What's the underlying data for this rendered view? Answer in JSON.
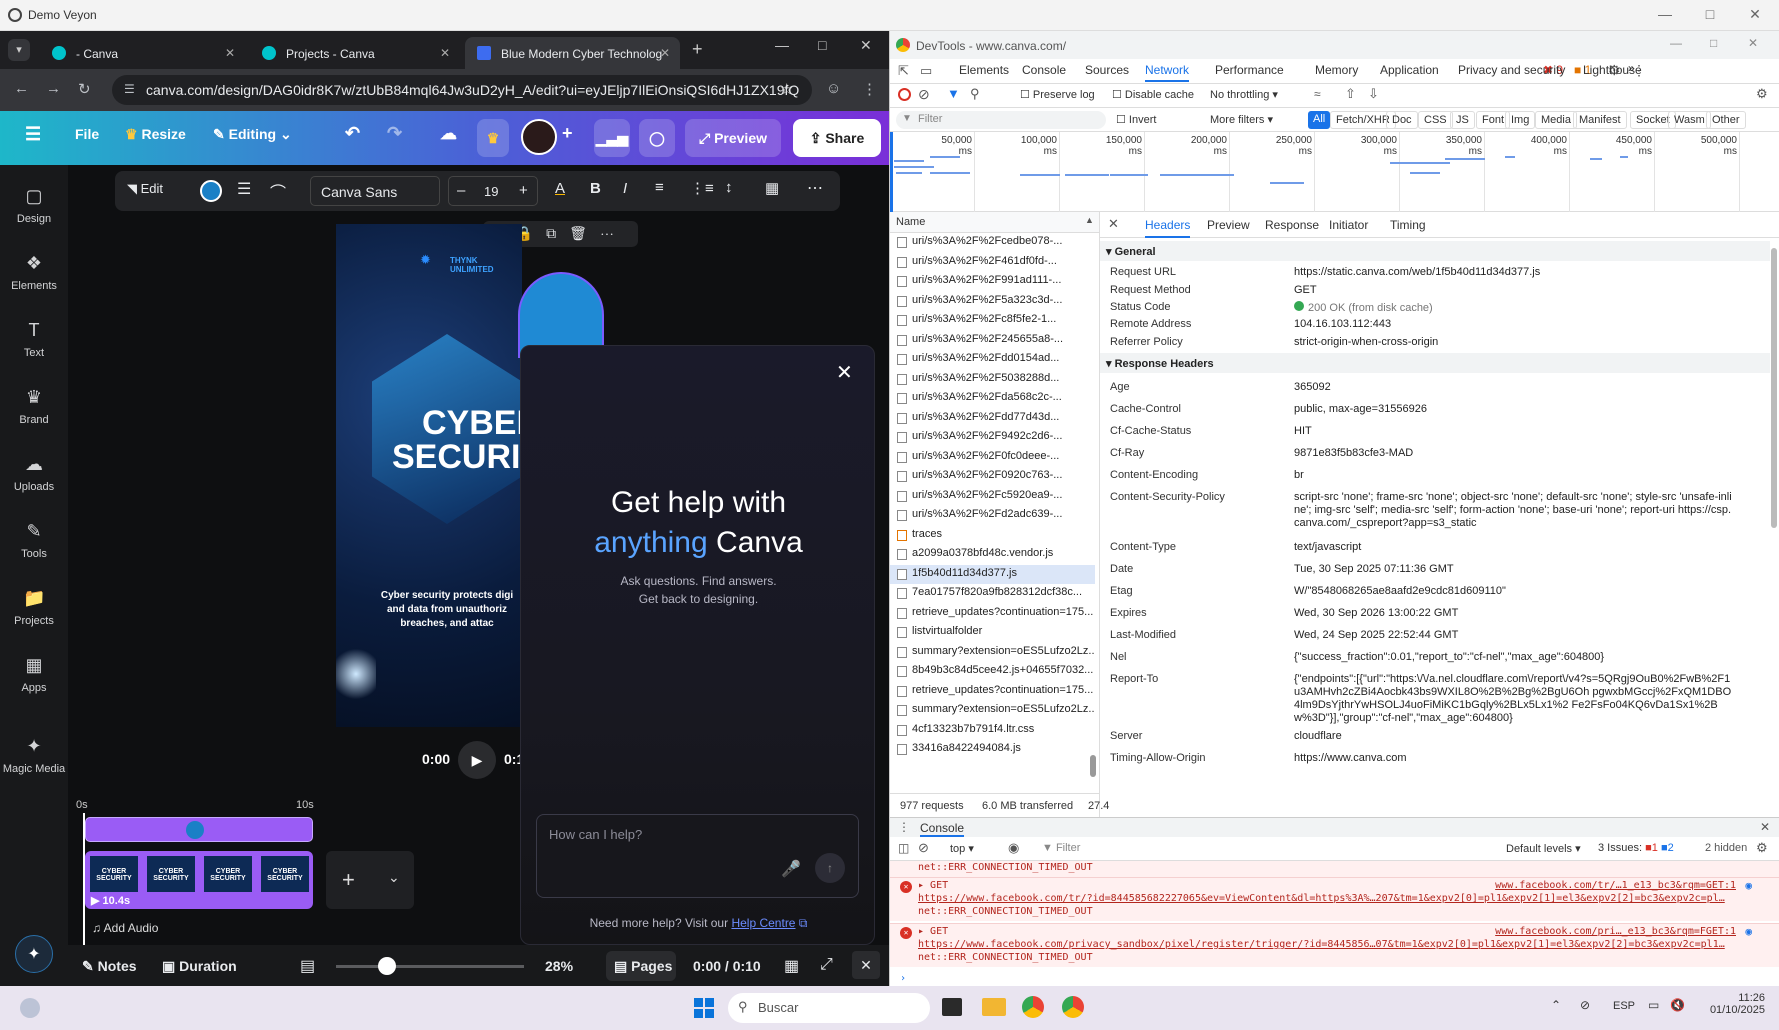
{
  "app_window": {
    "title": "Demo Veyon"
  },
  "browser": {
    "tabs": [
      {
        "label": "- Canva"
      },
      {
        "label": "Projects - Canva"
      },
      {
        "label": "Blue Modern Cyber Technolog"
      }
    ],
    "url": "canva.com/design/DAG0idr8K7w/ztUbB84mql64Jw3uD2yH_A/edit?ui=eyJEljp7IlEiOnsiQSI6dHJ1ZX19fQ"
  },
  "canva": {
    "header": {
      "file": "File",
      "resize": "Resize",
      "editing": "Editing",
      "preview": "Preview",
      "share": "Share"
    },
    "rail": [
      {
        "label": "Design",
        "icon": "design-icon"
      },
      {
        "label": "Elements",
        "icon": "elements-icon"
      },
      {
        "label": "Text",
        "icon": "text-icon"
      },
      {
        "label": "Brand",
        "icon": "brand-icon"
      },
      {
        "label": "Uploads",
        "icon": "uploads-icon"
      },
      {
        "label": "Tools",
        "icon": "tools-icon"
      },
      {
        "label": "Projects",
        "icon": "projects-icon"
      },
      {
        "label": "Apps",
        "icon": "apps-icon"
      },
      {
        "label": "Magic Media",
        "icon": "magic-media-icon"
      }
    ],
    "toolbar": {
      "edit": "Edit",
      "font": "Canva Sans",
      "font_size": "19",
      "minus": "–",
      "plus": "+"
    },
    "design": {
      "brand": "THYNK UNLIMITED",
      "title1": "CYBER",
      "title2": "SECURI",
      "body": "Cyber security protects digi and data from unauthoriz breaches, and attac"
    },
    "playback": {
      "time": "0:00",
      "time2": "0:1"
    },
    "help_panel": {
      "title1": "Get help with",
      "title2_accent": "anything",
      "title2_rest": "Canva",
      "sub1": "Ask questions. Find answers.",
      "sub2": "Get back to designing.",
      "input_placeholder": "How can I help?",
      "footer_prefix": "Need more help? Visit our",
      "footer_link": "Help Centre"
    },
    "timeline": {
      "start": "0s",
      "mark": "10s",
      "clip_label": "CYBER SECURITY",
      "duration_badge": "10.4s",
      "add_audio": "Add Audio"
    },
    "bottom": {
      "notes": "Notes",
      "duration": "Duration",
      "zoom": "28%",
      "pages": "Pages",
      "time": "0:00 / 0:10"
    }
  },
  "devtools": {
    "title": "DevTools - www.canva.com/",
    "tabs": [
      "Elements",
      "Console",
      "Sources",
      "Network",
      "Performance",
      "Memory",
      "Application",
      "Privacy and security",
      "Lighthouse"
    ],
    "active_tab": "Network",
    "errors": "9",
    "warnings": "1",
    "toolbar": {
      "preserve_log": "Preserve log",
      "disable_cache": "Disable cache",
      "throttling": "No throttling"
    },
    "filter": {
      "placeholder": "Filter",
      "invert": "Invert",
      "more_filters": "More filters"
    },
    "filter_types": [
      "All",
      "Fetch/XHR",
      "Doc",
      "CSS",
      "JS",
      "Font",
      "Img",
      "Media",
      "Manifest",
      "Socket",
      "Wasm",
      "Other"
    ],
    "timeline_ticks": [
      "50,000 ms",
      "100,000 ms",
      "150,000 ms",
      "200,000 ms",
      "250,000 ms",
      "300,000 ms",
      "350,000 ms",
      "400,000 ms",
      "450,000 ms",
      "500,000 ms"
    ],
    "name_header": "Name",
    "requests": [
      "uri/s%3A%2F%2Fcedbe078-...",
      "uri/s%3A%2F%2F461df0fd-...",
      "uri/s%3A%2F%2F991ad111-...",
      "uri/s%3A%2F%2F5a323c3d-...",
      "uri/s%3A%2F%2Fc8f5fe2-1...",
      "uri/s%3A%2F%2F245655a8-...",
      "uri/s%3A%2F%2Fdd0154ad...",
      "uri/s%3A%2F%2F5038288d...",
      "uri/s%3A%2F%2Fda568c2c-...",
      "uri/s%3A%2F%2Fdd77d43d...",
      "uri/s%3A%2F%2F9492c2d6-...",
      "uri/s%3A%2F%2F0fc0deee-...",
      "uri/s%3A%2F%2F0920c763-...",
      "uri/s%3A%2F%2Fc5920ea9-...",
      "uri/s%3A%2F%2Fd2adc639-...",
      "traces",
      "a2099a0378bfd48c.vendor.js",
      "1f5b40d11d34d377.js",
      "7ea01757f820a9fb828312dcf38c...",
      "retrieve_updates?continuation=175...",
      "listvirtualfolder",
      "summary?extension=oES5Lufzo2Lz...",
      "8b49b3c84d5cee42.js+04655f7032...",
      "retrieve_updates?continuation=175...",
      "summary?extension=oES5Lufzo2Lz...",
      "4cf13323b7b791f4.ltr.css",
      "33416a8422494084.js"
    ],
    "summary": {
      "requests": "977 requests",
      "transferred": "6.0 MB transferred",
      "extra": "27.4"
    },
    "detail_tabs": [
      "Headers",
      "Preview",
      "Response",
      "Initiator",
      "Timing"
    ],
    "general_title": "General",
    "general": [
      {
        "k": "Request URL",
        "v": "https://static.canva.com/web/1f5b40d11d34d377.js"
      },
      {
        "k": "Request Method",
        "v": "GET"
      },
      {
        "k": "Status Code",
        "v": "200 OK (from disk cache)"
      },
      {
        "k": "Remote Address",
        "v": "104.16.103.112:443"
      },
      {
        "k": "Referrer Policy",
        "v": "strict-origin-when-cross-origin"
      }
    ],
    "response_title": "Response Headers",
    "response": [
      {
        "k": "Age",
        "v": "365092"
      },
      {
        "k": "Cache-Control",
        "v": "public, max-age=31556926"
      },
      {
        "k": "Cf-Cache-Status",
        "v": "HIT"
      },
      {
        "k": "Cf-Ray",
        "v": "9871e83f5b83cfe3-MAD"
      },
      {
        "k": "Content-Encoding",
        "v": "br"
      },
      {
        "k": "Content-Security-Policy",
        "v": "script-src 'none'; frame-src 'none'; object-src 'none'; default-src 'none'; style-src 'unsafe-inline'; img-src 'self'; media-src 'self'; form-action 'none'; base-uri 'none'; report-uri https://csp.canva.com/_cspreport?app=s3_static"
      },
      {
        "k": "Content-Type",
        "v": "text/javascript"
      },
      {
        "k": "Date",
        "v": "Tue, 30 Sep 2025 07:11:36 GMT"
      },
      {
        "k": "Etag",
        "v": "W/\"8548068265ae8aafd2e9cdc81d609110\""
      },
      {
        "k": "Expires",
        "v": "Wed, 30 Sep 2026 13:00:22 GMT"
      },
      {
        "k": "Last-Modified",
        "v": "Wed, 24 Sep 2025 22:52:44 GMT"
      },
      {
        "k": "Nel",
        "v": "{\"success_fraction\":0.01,\"report_to\":\"cf-nel\",\"max_age\":604800}"
      },
      {
        "k": "Report-To",
        "v": "{\"endpoints\":[{\"url\":\"https:\\/\\/a.nel.cloudflare.com\\/report\\/v4?s=5QRgj9OuB0%2FwB%2F1u3AMHvh2cZBi4Aocbk43bs9WXIL8O%2B%2Bg%2BgU6Oh pgwxbMGccj%2FxQM1DBO4lm9DsYjthrYwHSOLJ4uoFiMiKC1bGqly%2BLx5Lx1%2 Fe2FsFo04KQ6vDa1Sx1%2Bw%3D\"}],\"group\":\"cf-nel\",\"max_age\":604800}"
      },
      {
        "k": "Server",
        "v": "cloudflare"
      },
      {
        "k": "Timing-Allow-Origin",
        "v": "https://www.canva.com"
      }
    ],
    "console": {
      "title": "Console",
      "context": "top",
      "filter": "Filter",
      "levels": "Default levels",
      "issues": "3 Issues:",
      "issues_err": "1",
      "issues_info": "2",
      "hidden": "2 hidden",
      "lines": [
        {
          "kind": "plain",
          "text": "net::ERR_CONNECTION_TIMED_OUT"
        },
        {
          "kind": "get",
          "method": "GET",
          "src": "www.facebook.com/tr/…1_e13_bc3&rqm=GET:1",
          "url": "https://www.facebook.com/tr/?id=844585682227065&ev=ViewContent&dl=https%3A%…207&tm=1&expv2[0]=pl1&expv2[1]=el3&expv2[2]=bc3&expv2c=pl…",
          "err": "net::ERR_CONNECTION_TIMED_OUT"
        },
        {
          "kind": "get",
          "method": "GET",
          "src": "www.facebook.com/pri…_e13_bc3&rqm=FGET:1",
          "url": "https://www.facebook.com/privacy_sandbox/pixel/register/trigger/?id=8445856…07&tm=1&expv2[0]=pl1&expv2[1]=el3&expv2[2]=bc3&expv2c=pl1…",
          "err": "net::ERR_CONNECTION_TIMED_OUT"
        }
      ]
    }
  },
  "taskbar": {
    "search": "Buscar",
    "lang": "ESP",
    "time": "11:26",
    "date": "01/10/2025"
  }
}
